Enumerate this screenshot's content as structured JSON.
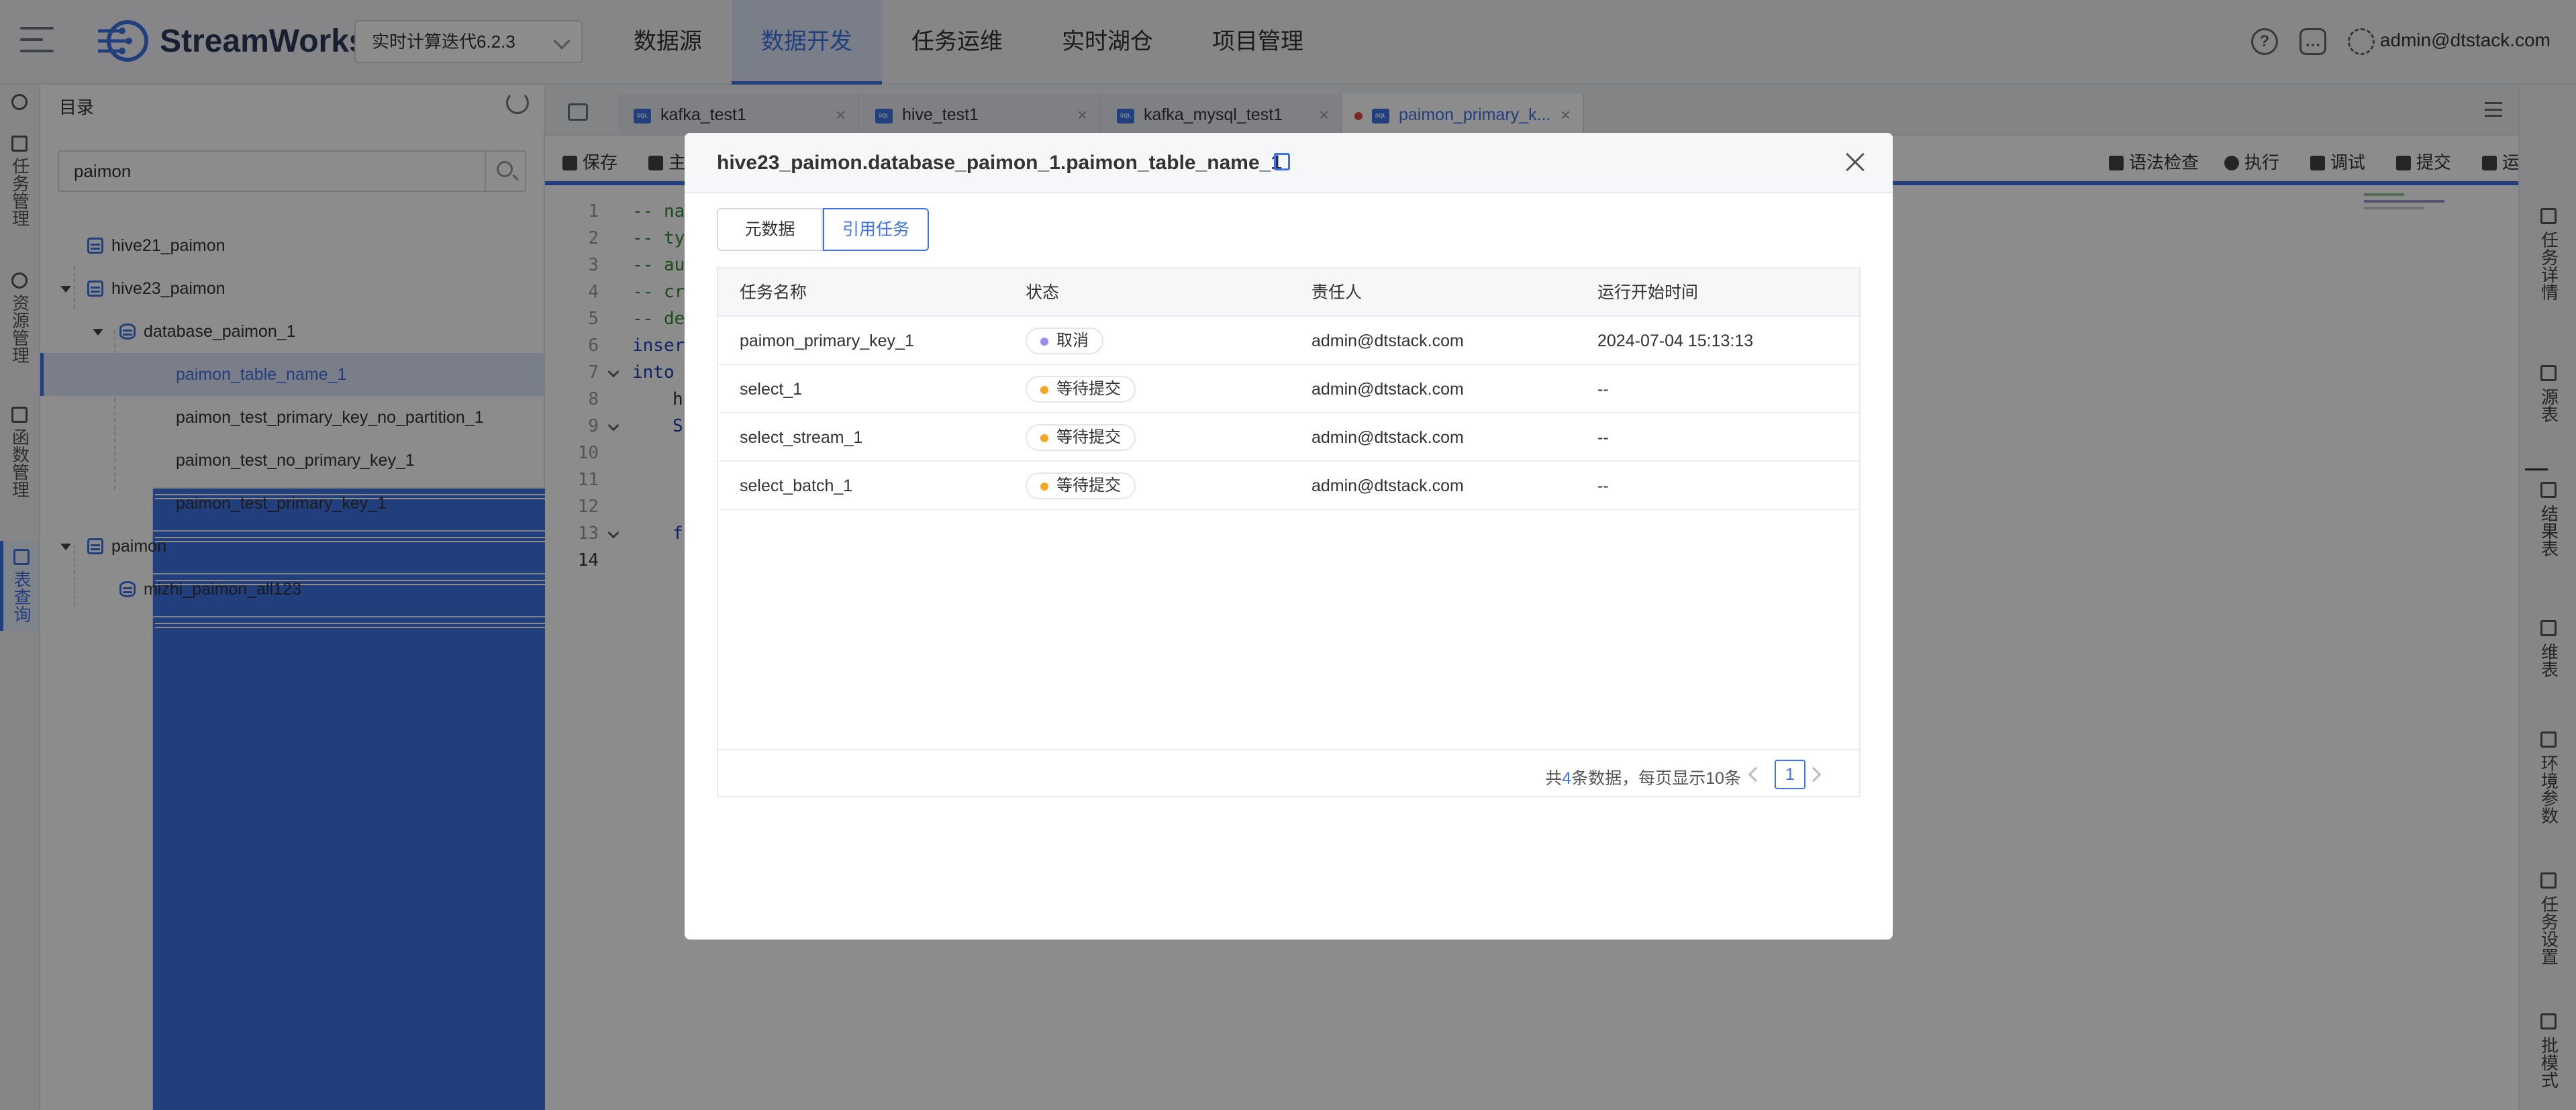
{
  "header": {
    "brand": "StreamWorks",
    "version_select": "实时计算迭代6.2.3",
    "nav": [
      "数据源",
      "数据开发",
      "任务运维",
      "实时湖仓",
      "项目管理"
    ],
    "active_nav": "数据开发",
    "user": "admin@dtstack.com"
  },
  "left_rail": [
    {
      "label": "任务管理",
      "icon": "task-icon"
    },
    {
      "label": "资源管理",
      "icon": "resource-icon"
    },
    {
      "label": "函数管理",
      "icon": "function-icon"
    },
    {
      "label": "表查询",
      "icon": "table-query-icon"
    }
  ],
  "directory": {
    "title": "目录",
    "search_value": "paimon",
    "tree": [
      {
        "label": "hive21_paimon",
        "type": "catalog"
      },
      {
        "label": "hive23_paimon",
        "type": "catalog"
      },
      {
        "label": "database_paimon_1",
        "type": "database"
      },
      {
        "label": "paimon_table_name_1",
        "type": "table",
        "selected": true
      },
      {
        "label": "paimon_test_primary_key_no_partition_1",
        "type": "table"
      },
      {
        "label": "paimon_test_no_primary_key_1",
        "type": "table"
      },
      {
        "label": "paimon_test_primary_key_1",
        "type": "table"
      },
      {
        "label": "paimon",
        "type": "catalog"
      },
      {
        "label": "mizhi_paimon_all123",
        "type": "database"
      }
    ]
  },
  "editor": {
    "tabs": [
      "kafka_test1",
      "hive_test1",
      "kafka_mysql_test1",
      "paimon_primary_k..."
    ],
    "active_tab": "paimon_primary_k...",
    "toolbar_left": [
      "保存",
      "主"
    ],
    "toolbar_right": [
      "语法检查",
      "执行",
      "调试",
      "提交",
      "运维"
    ],
    "line_numbers": [
      "1",
      "2",
      "3",
      "4",
      "5",
      "6",
      "7",
      "8",
      "9",
      "10",
      "11",
      "12",
      "13",
      "14"
    ],
    "code_lines": [
      "-- na",
      "-- ty",
      "-- au",
      "-- cr",
      "-- de",
      "inser",
      "into",
      "h",
      "S",
      "",
      "",
      "",
      "f",
      ""
    ]
  },
  "right_rail": [
    {
      "label": "任务详情",
      "icon": "detail-icon"
    },
    {
      "label": "源表",
      "icon": "source-table-icon"
    },
    {
      "label": "结果表",
      "icon": "result-table-icon"
    },
    {
      "label": "维表",
      "icon": "dim-table-icon"
    },
    {
      "label": "环境参数",
      "icon": "env-params-icon"
    },
    {
      "label": "任务设置",
      "icon": "task-settings-icon"
    },
    {
      "label": "批模式",
      "icon": "batch-mode-icon"
    }
  ],
  "modal": {
    "title": "hive23_paimon.database_paimon_1.paimon_table_name_1",
    "tabs": [
      "元数据",
      "引用任务"
    ],
    "active_tab": "引用任务",
    "columns": [
      "任务名称",
      "状态",
      "责任人",
      "运行开始时间"
    ],
    "rows": [
      {
        "name": "paimon_primary_key_1",
        "status": "取消",
        "status_color": "#9a8cf0",
        "owner": "admin@dtstack.com",
        "start": "2024-07-04 15:13:13"
      },
      {
        "name": "select_1",
        "status": "等待提交",
        "status_color": "#f5a623",
        "owner": "admin@dtstack.com",
        "start": "--"
      },
      {
        "name": "select_stream_1",
        "status": "等待提交",
        "status_color": "#f5a623",
        "owner": "admin@dtstack.com",
        "start": "--"
      },
      {
        "name": "select_batch_1",
        "status": "等待提交",
        "status_color": "#f5a623",
        "owner": "admin@dtstack.com",
        "start": "--"
      }
    ],
    "pagination": {
      "prefix": "共",
      "total": "4",
      "suffix": "条数据，每页显示10条",
      "current_page": "1"
    }
  },
  "colors": {
    "accent": "#3f73e4",
    "mask": "rgba(0,0,0,0.45)"
  }
}
